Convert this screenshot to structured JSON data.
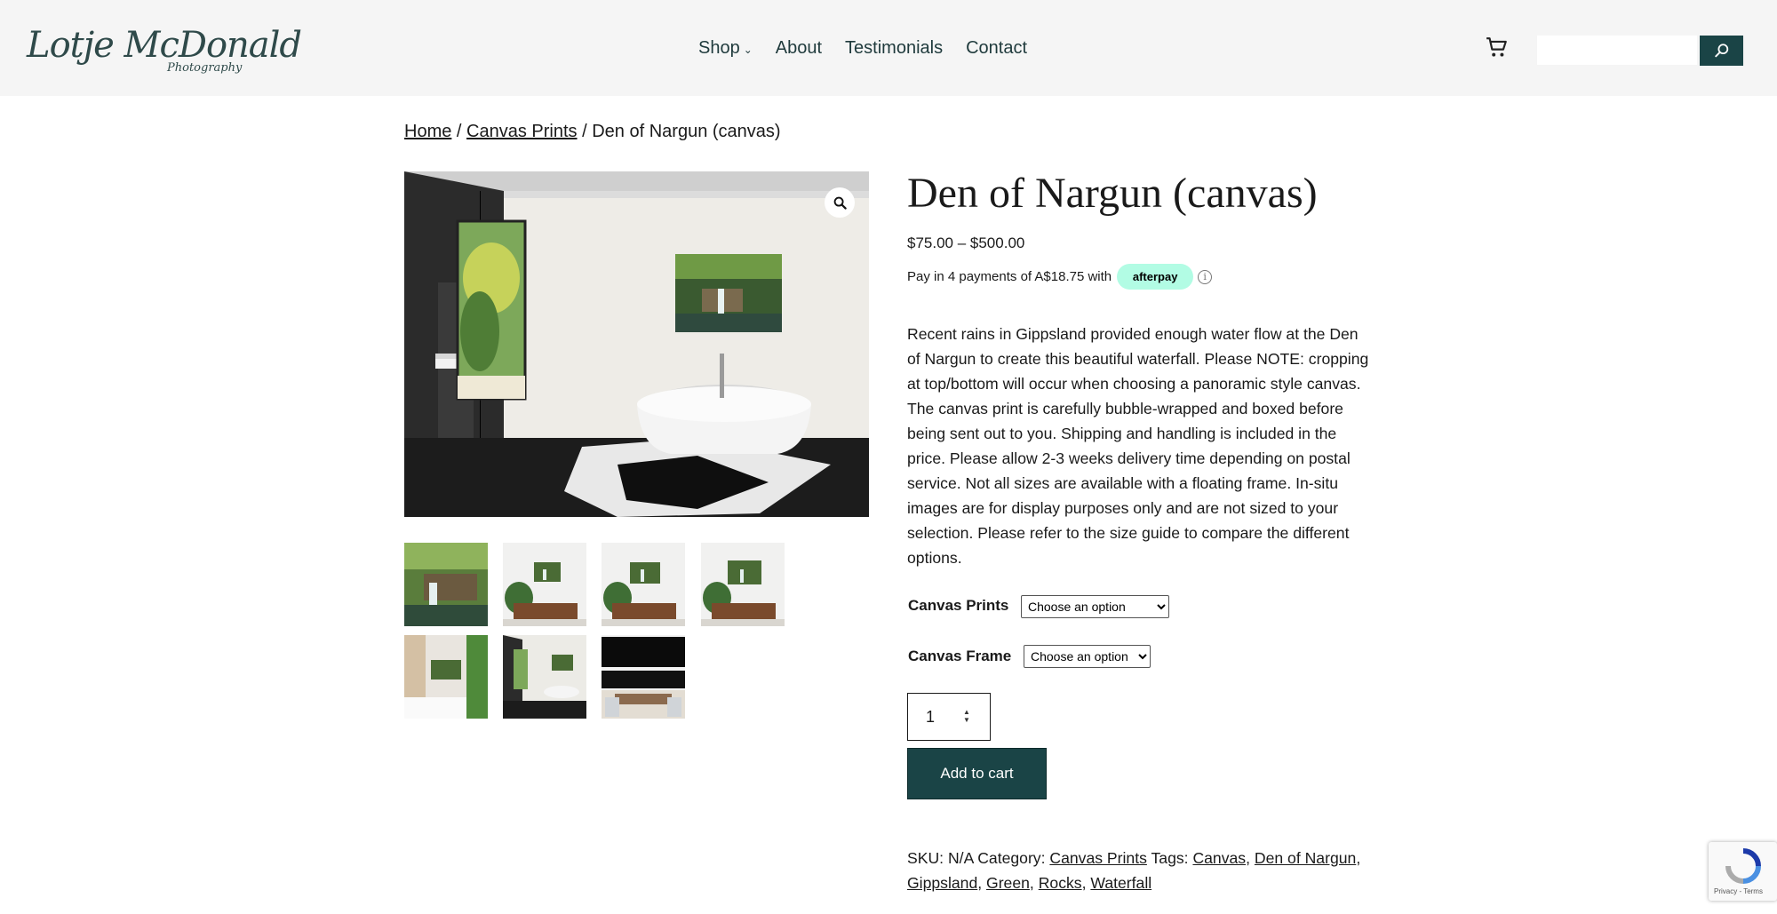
{
  "header": {
    "logo_script": "Lotje McDonald",
    "logo_sub": "Photography",
    "nav": [
      {
        "label": "Shop"
      },
      {
        "label": "About"
      },
      {
        "label": "Testimonials"
      },
      {
        "label": "Contact"
      }
    ],
    "search_placeholder": ""
  },
  "breadcrumb": {
    "home": "Home",
    "separator": "/",
    "category": "Canvas Prints",
    "current": "Den of Nargun (canvas)"
  },
  "product": {
    "title": "Den of Nargun (canvas)",
    "price_range": "$75.00 – $500.00",
    "afterpay_text": "Pay in 4 payments of A$18.75 with",
    "afterpay_badge": "afterpay",
    "description": "Recent rains in Gippsland provided enough water flow at the Den of Nargun to create this beautiful waterfall. Please NOTE: cropping at top/bottom will occur when choosing a panoramic style canvas. The canvas print is carefully bubble-wrapped and boxed before being sent out to you. Shipping and handling is included in the price. Please allow 2-3 weeks delivery time depending on postal service. Not all sizes are available with a floating frame. In-situ images are for display purposes only and are not sized to your selection. Please refer to the size guide to compare the different options.",
    "variations": [
      {
        "label": "Canvas Prints",
        "selected": "Choose an option"
      },
      {
        "label": "Canvas Frame",
        "selected": "Choose an option"
      }
    ],
    "quantity": "1",
    "add_to_cart": "Add to cart"
  },
  "meta": {
    "sku_label": "SKU:",
    "sku": "N/A",
    "category_label": "Category:",
    "category": "Canvas Prints",
    "tags_label": "Tags:",
    "tags": [
      "Canvas",
      "Den of Nargun",
      "Gippsland",
      "Green",
      "Rocks",
      "Waterfall"
    ]
  },
  "recaptcha": {
    "terms": "Privacy - Terms"
  },
  "colors": {
    "brand_teal": "#1a4446",
    "header_bg": "#f5f5f5",
    "afterpay_mint": "#b2fce4"
  },
  "icons": [
    "cart-icon",
    "search-icon",
    "zoom-icon",
    "info-icon",
    "chevron-down-icon",
    "recaptcha-icon"
  ]
}
